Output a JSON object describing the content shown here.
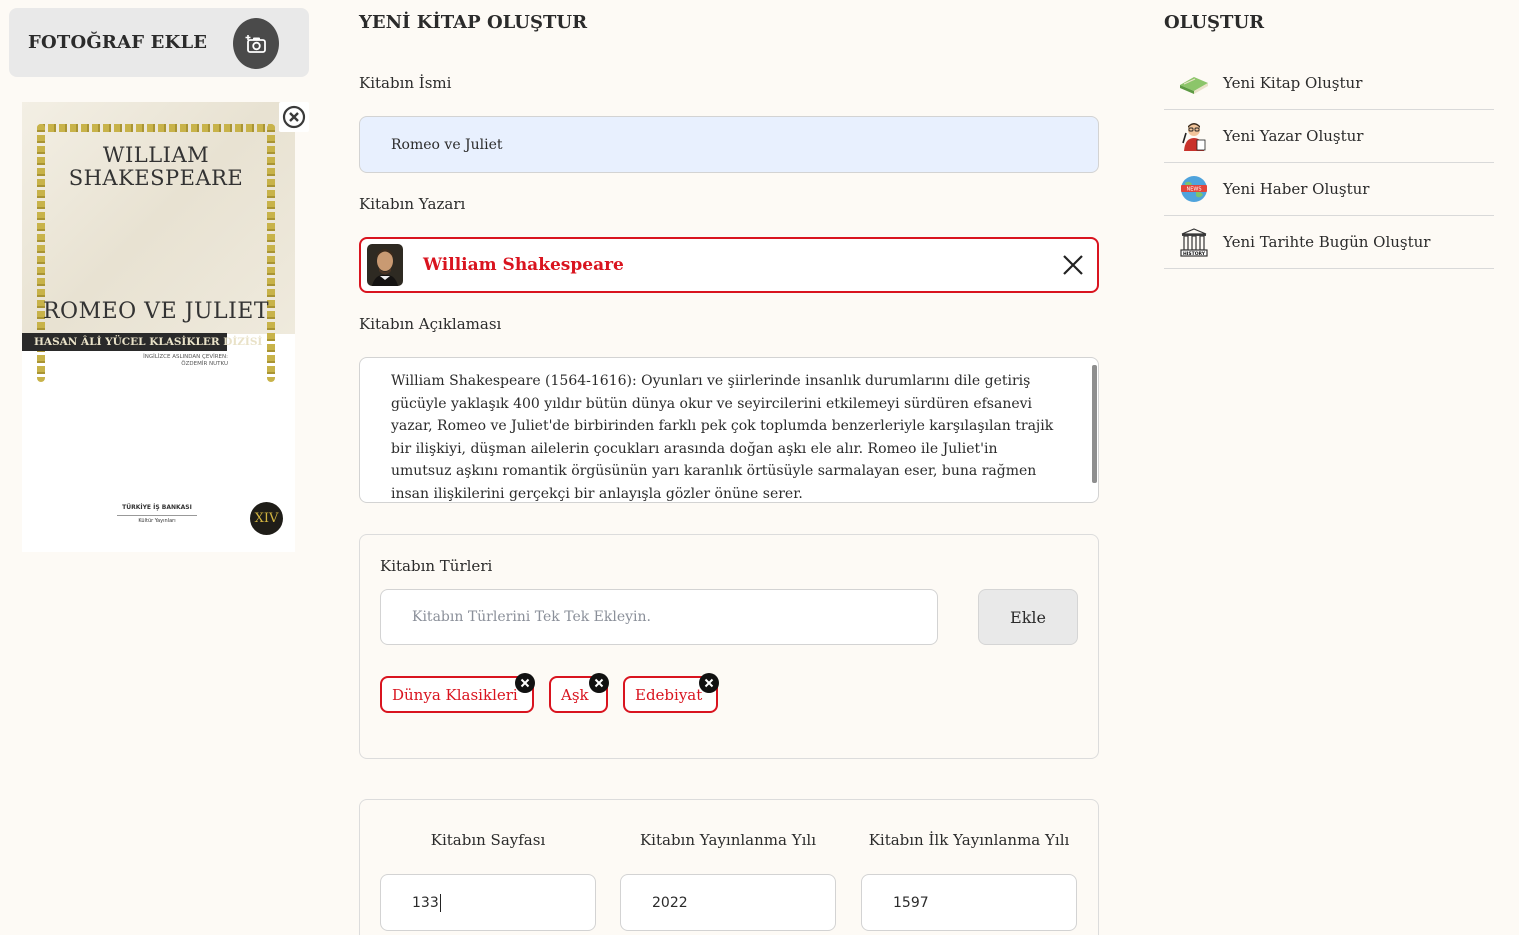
{
  "left": {
    "add_photo_label": "FOTOĞRAF EKLE",
    "cover": {
      "author_line1": "WILLIAM",
      "author_line2": "SHAKESPEARE",
      "title": "ROMEO VE JULIET",
      "series": "HASAN ÂLİ YÜCEL KLASİKLER DİZİSİ",
      "translator_line1": "İNGİLİZCE ASLINDAN ÇEVİREN:",
      "translator_line2": "ÖZDEMİR NUTKU",
      "publisher": "TÜRKİYE İŞ BANKASI",
      "publisher_sub": "Kültür Yayınları",
      "edition": "XIV"
    }
  },
  "form": {
    "page_title": "YENİ KİTAP OLUŞTUR",
    "name_label": "Kitabın İsmi",
    "name_value": "Romeo ve Juliet",
    "author_label": "Kitabın Yazarı",
    "author_value": "William Shakespeare",
    "description_label": "Kitabın Açıklaması",
    "description_value": "William Shakespeare (1564-1616): Oyunları ve şiirlerinde insanlık durumlarını dile getiriş gücüyle yaklaşık 400 yıldır bütün dünya okur ve seyircilerini etkilemeyi sürdüren efsanevi yazar, Romeo ve Juliet'de birbirinden farklı pek çok toplumda benzerleriyle karşılaşılan trajik bir ilişkiyi, düşman ailelerin çocukları arasında doğan aşkı ele alır. Romeo ile Juliet'in umutsuz aşkını romantik örgüsünün yarı karanlık örtüsüyle sarmalayan eser, buna rağmen insan ilişkilerini gerçekçi bir anlayışla gözler önüne serer.",
    "genres_label": "Kitabın Türleri",
    "genres_placeholder": "Kitabın Türlerini Tek Tek Ekleyin.",
    "add_button": "Ekle",
    "genres": [
      "Dünya Klasikleri",
      "Aşk",
      "Edebiyat"
    ],
    "pages_label": "Kitabın Sayfası",
    "pages_value": "133",
    "pub_year_label": "Kitabın Yayınlanma Yılı",
    "pub_year_value": "2022",
    "first_pub_year_label": "Kitabın İlk Yayınlanma Yılı",
    "first_pub_year_value": "1597"
  },
  "sidebar": {
    "title": "OLUŞTUR",
    "items": [
      {
        "label": "Yeni Kitap Oluştur",
        "icon": "book-icon"
      },
      {
        "label": "Yeni Yazar Oluştur",
        "icon": "writer-icon"
      },
      {
        "label": "Yeni Haber Oluştur",
        "icon": "news-globe-icon"
      },
      {
        "label": "Yeni Tarihte Bugün Oluştur",
        "icon": "history-icon"
      }
    ]
  },
  "colors": {
    "accent_red": "#d9141f",
    "background": "#fdfaf5",
    "autofill_blue": "#e8f0fe"
  }
}
